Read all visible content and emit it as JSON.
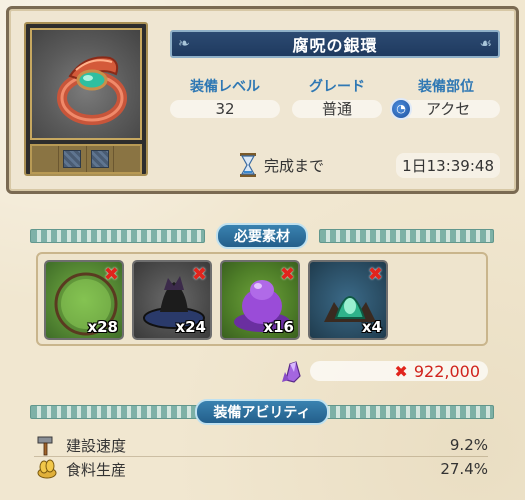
{
  "item": {
    "name": "腐呪の銀環",
    "icon": "ring-icon",
    "slots": [
      {
        "filled": false
      },
      {
        "filled": true
      },
      {
        "filled": true
      },
      {
        "filled": false
      }
    ]
  },
  "stats": {
    "level_label": "装備レベル",
    "level_value": "32",
    "grade_label": "グレード",
    "grade_value": "普通",
    "part_label": "装備部位",
    "part_value": "アクセ",
    "part_icon": "accessory-icon"
  },
  "time": {
    "label": "完成まで",
    "value": "1日13:39:48",
    "icon": "hourglass-icon"
  },
  "materials": {
    "header": "必要素材",
    "items": [
      {
        "icon": "green-wreath-icon",
        "qty": "x28",
        "missing": true
      },
      {
        "icon": "dark-cauldron-icon",
        "qty": "x24",
        "missing": true
      },
      {
        "icon": "purple-slime-icon",
        "qty": "x16",
        "missing": true
      },
      {
        "icon": "teal-flame-icon",
        "qty": "x4",
        "missing": true
      }
    ]
  },
  "cost": {
    "icon": "crystal-icon",
    "value": "922,000",
    "insufficient": true
  },
  "abilities": {
    "header": "装備アビリティ",
    "items": [
      {
        "icon": "hammer-icon",
        "label": "建設速度",
        "value": "9.2%"
      },
      {
        "icon": "grain-icon",
        "label": "食料生産",
        "value": "27.4%"
      }
    ]
  },
  "colors": {
    "title_bg": "#1f3a5f",
    "stat_label": "#2f78b4",
    "missing_red": "#e1241c",
    "section_pill": "#2e6f9c"
  }
}
